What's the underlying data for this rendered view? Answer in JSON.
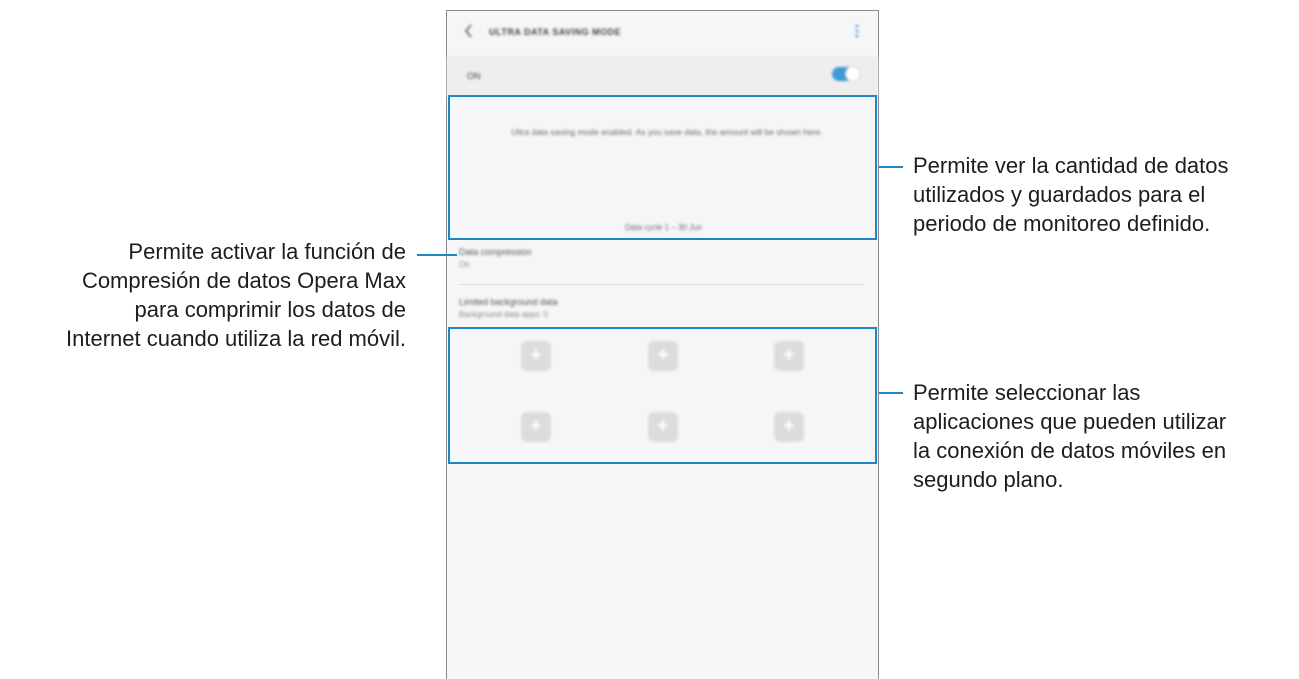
{
  "screen": {
    "app_bar": {
      "title": "ULTRA DATA SAVING MODE",
      "back_icon": "chevron-left",
      "more_icon": "vertical-ellipsis"
    },
    "master_switch": {
      "label": "ON",
      "state": "on",
      "accent_color": "#3e9ad9"
    },
    "summary": {
      "message": "Ultra data saving mode enabled. As you save data, the amount will be shown here.",
      "cycle": "Data cycle 1 – 30 Jun"
    },
    "settings": [
      {
        "title": "Data compression",
        "subtitle": "On"
      },
      {
        "title": "Limited background data",
        "subtitle": "Background data apps: 0"
      }
    ],
    "app_slots": [
      "+",
      "+",
      "+",
      "+",
      "+",
      "+"
    ]
  },
  "annotations": {
    "summary_note": [
      "Permite ver la cantidad de datos",
      "utilizados y guardados para el",
      "periodo de monitoreo definido."
    ],
    "compression_note": [
      "Permite activar la función de",
      "Compresión de datos Opera Max",
      "para comprimir los datos de",
      "Internet cuando utiliza la red móvil."
    ],
    "apps_note": [
      "Permite seleccionar las",
      "aplicaciones que pueden utilizar",
      "la conexión de datos móviles en",
      "segundo plano."
    ],
    "highlight_color": "#1e88c7"
  }
}
